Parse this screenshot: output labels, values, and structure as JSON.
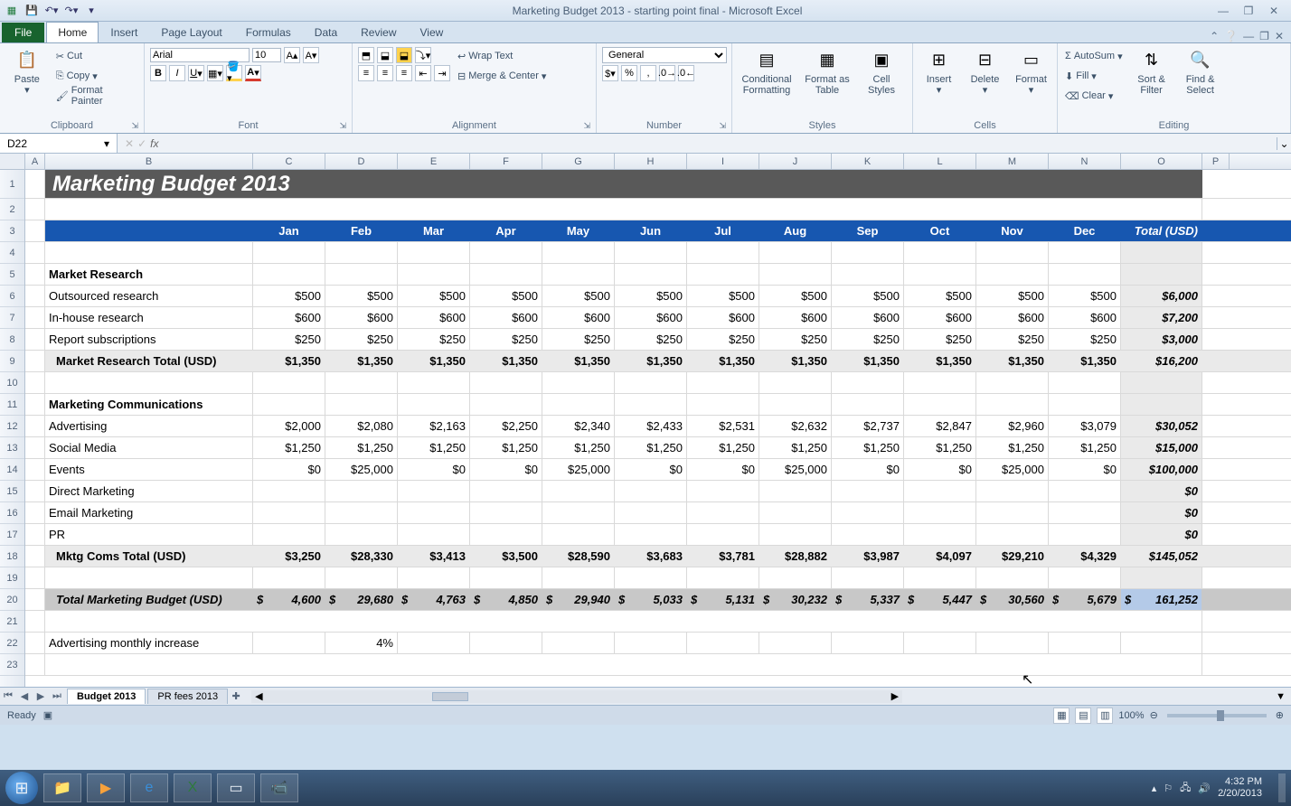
{
  "app_title": "Marketing Budget 2013 - starting point final - Microsoft Excel",
  "tabs": {
    "file": "File",
    "home": "Home",
    "insert": "Insert",
    "pagelayout": "Page Layout",
    "formulas": "Formulas",
    "data": "Data",
    "review": "Review",
    "view": "View"
  },
  "ribbon": {
    "clipboard": {
      "title": "Clipboard",
      "paste": "Paste",
      "cut": "Cut",
      "copy": "Copy",
      "formatpainter": "Format Painter"
    },
    "font": {
      "title": "Font",
      "name": "Arial",
      "size": "10"
    },
    "alignment": {
      "title": "Alignment",
      "wrap": "Wrap Text",
      "merge": "Merge & Center"
    },
    "number": {
      "title": "Number",
      "format": "General"
    },
    "styles": {
      "title": "Styles",
      "cond": "Conditional Formatting",
      "table": "Format as Table",
      "cell": "Cell Styles"
    },
    "cells": {
      "title": "Cells",
      "insert": "Insert",
      "delete": "Delete",
      "format": "Format"
    },
    "editing": {
      "title": "Editing",
      "autosum": "AutoSum",
      "fill": "Fill",
      "clear": "Clear",
      "sort": "Sort & Filter",
      "find": "Find & Select"
    }
  },
  "namebox": "D22",
  "cols": [
    "A",
    "B",
    "C",
    "D",
    "E",
    "F",
    "G",
    "H",
    "I",
    "J",
    "K",
    "L",
    "M",
    "N",
    "O",
    "P"
  ],
  "rownums": [
    "1",
    "2",
    "3",
    "4",
    "5",
    "6",
    "7",
    "8",
    "9",
    "10",
    "11",
    "12",
    "13",
    "14",
    "15",
    "16",
    "17",
    "18",
    "19",
    "20",
    "21",
    "22",
    "23"
  ],
  "sheet": {
    "title": "Marketing Budget 2013",
    "months": [
      "Jan",
      "Feb",
      "Mar",
      "Apr",
      "May",
      "Jun",
      "Jul",
      "Aug",
      "Sep",
      "Oct",
      "Nov",
      "Dec"
    ],
    "totallabel": "Total (USD)",
    "section1": "Market Research",
    "s1r1": {
      "label": "Outsourced research",
      "v": [
        "$500",
        "$500",
        "$500",
        "$500",
        "$500",
        "$500",
        "$500",
        "$500",
        "$500",
        "$500",
        "$500",
        "$500"
      ],
      "t": "$6,000"
    },
    "s1r2": {
      "label": "In-house research",
      "v": [
        "$600",
        "$600",
        "$600",
        "$600",
        "$600",
        "$600",
        "$600",
        "$600",
        "$600",
        "$600",
        "$600",
        "$600"
      ],
      "t": "$7,200"
    },
    "s1r3": {
      "label": "Report subscriptions",
      "v": [
        "$250",
        "$250",
        "$250",
        "$250",
        "$250",
        "$250",
        "$250",
        "$250",
        "$250",
        "$250",
        "$250",
        "$250"
      ],
      "t": "$3,000"
    },
    "s1total": {
      "label": "Market Research Total (USD)",
      "v": [
        "$1,350",
        "$1,350",
        "$1,350",
        "$1,350",
        "$1,350",
        "$1,350",
        "$1,350",
        "$1,350",
        "$1,350",
        "$1,350",
        "$1,350",
        "$1,350"
      ],
      "t": "$16,200"
    },
    "section2": "Marketing Communications",
    "s2r1": {
      "label": "Advertising",
      "v": [
        "$2,000",
        "$2,080",
        "$2,163",
        "$2,250",
        "$2,340",
        "$2,433",
        "$2,531",
        "$2,632",
        "$2,737",
        "$2,847",
        "$2,960",
        "$3,079"
      ],
      "t": "$30,052"
    },
    "s2r2": {
      "label": "Social Media",
      "v": [
        "$1,250",
        "$1,250",
        "$1,250",
        "$1,250",
        "$1,250",
        "$1,250",
        "$1,250",
        "$1,250",
        "$1,250",
        "$1,250",
        "$1,250",
        "$1,250"
      ],
      "t": "$15,000"
    },
    "s2r3": {
      "label": "Events",
      "v": [
        "$0",
        "$25,000",
        "$0",
        "$0",
        "$25,000",
        "$0",
        "$0",
        "$25,000",
        "$0",
        "$0",
        "$25,000",
        "$0"
      ],
      "t": "$100,000"
    },
    "s2r4": {
      "label": "Direct Marketing",
      "t": "$0"
    },
    "s2r5": {
      "label": "Email Marketing",
      "t": "$0"
    },
    "s2r6": {
      "label": "PR",
      "t": "$0"
    },
    "s2total": {
      "label": "Mktg Coms Total (USD)",
      "v": [
        "$3,250",
        "$28,330",
        "$3,413",
        "$3,500",
        "$28,590",
        "$3,683",
        "$3,781",
        "$28,882",
        "$3,987",
        "$4,097",
        "$29,210",
        "$4,329"
      ],
      "t": "$145,052"
    },
    "grandtotal": {
      "label": "Total Marketing Budget (USD)",
      "v": [
        "4,600",
        "29,680",
        "4,763",
        "4,850",
        "29,940",
        "5,033",
        "5,131",
        "30,232",
        "5,337",
        "5,447",
        "30,560",
        "5,679"
      ],
      "t": "161,252"
    },
    "note_label": "Advertising monthly increase",
    "note_val": "4%"
  },
  "sheettabs": {
    "t1": "Budget 2013",
    "t2": "PR fees 2013"
  },
  "status": "Ready",
  "zoom": "100%",
  "clock": {
    "time": "4:32 PM",
    "date": "2/20/2013"
  }
}
